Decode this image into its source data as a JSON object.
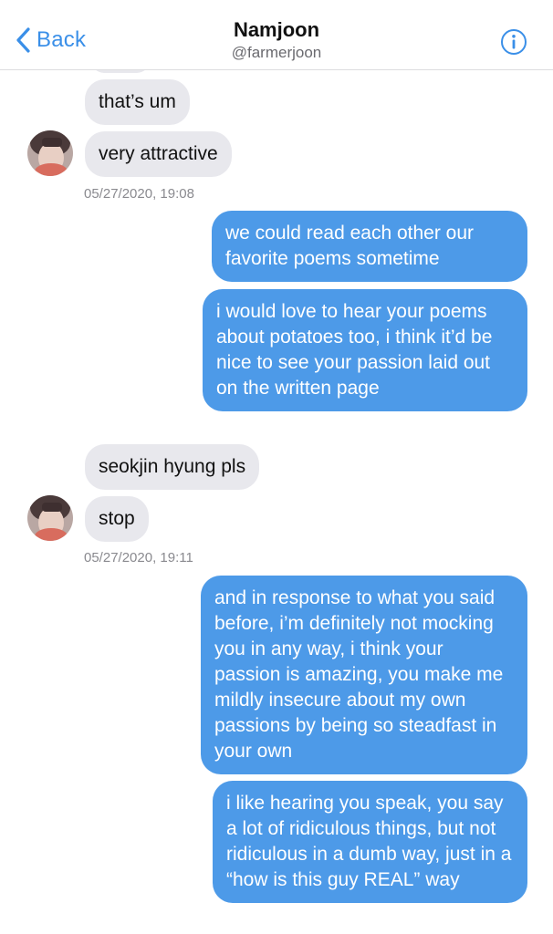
{
  "header": {
    "back_label": "Back",
    "contact_name": "Namjoon",
    "contact_handle": "@farmerjoon",
    "accent_color": "#3a8fe8"
  },
  "messages": [
    {
      "direction": "incoming",
      "text": "that’s um"
    },
    {
      "direction": "incoming",
      "text": "very attractive"
    },
    {
      "direction": "incoming",
      "timestamp": "05/27/2020, 19:08"
    },
    {
      "direction": "outgoing",
      "text": "we could read each other our favorite poems sometime"
    },
    {
      "direction": "outgoing",
      "text": "i would love to hear your poems about potatoes too, i think it’d be nice to see your passion laid out on the written page"
    },
    {
      "direction": "incoming",
      "text": "seokjin hyung pls"
    },
    {
      "direction": "incoming",
      "text": "stop"
    },
    {
      "direction": "incoming",
      "timestamp": "05/27/2020, 19:11"
    },
    {
      "direction": "outgoing",
      "text": "and in response to what you said before, i’m definitely not mocking you in any way, i think your passion is amazing, you make me mildly insecure about my own passions by being so steadfast in your own"
    },
    {
      "direction": "outgoing",
      "text": "i like hearing you speak, you say a lot of ridiculous things, but not ridiculous in a dumb way, just in a “how is this guy REAL” way"
    }
  ],
  "colors": {
    "incoming_bubble": "#e8e8ed",
    "outgoing_bubble": "#4d9ae8",
    "timestamp_text": "#8a8a8f"
  },
  "icons": [
    "chevron-left-icon",
    "info-icon",
    "avatar"
  ]
}
